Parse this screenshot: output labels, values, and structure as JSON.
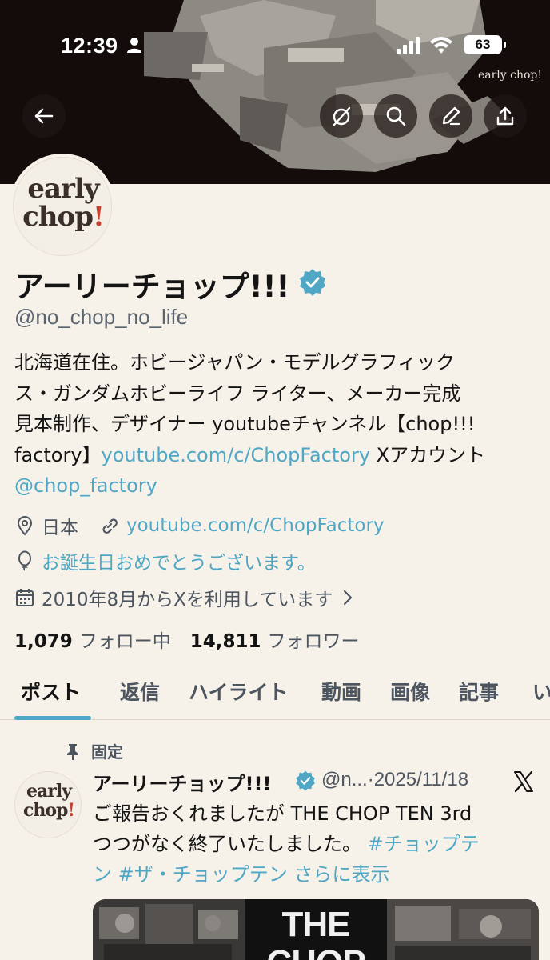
{
  "status_bar": {
    "time": "12:39",
    "battery": "63"
  },
  "banner": {
    "brand_text": "early chop!"
  },
  "avatar": {
    "line1": "early",
    "line2": "chop",
    "bang": "!"
  },
  "profile": {
    "display_name": "アーリーチョップ!!!",
    "handle": "@no_chop_no_life",
    "bio": {
      "line1": "北海道在住。ホビージャパン・モデルグラフィック",
      "line2": "ス・ガンダムホビーライフ ライター、メーカー完成",
      "line3": "見本制作、デザイナー youtubeチャンネル【chop!!!",
      "line4_text": "factory】",
      "line4_link": "youtube.com/c/ChopFactory",
      "line4_suffix": " Xアカウント",
      "line5_link": "@chop_factory"
    },
    "location": "日本",
    "website": "youtube.com/c/ChopFactory",
    "birthday": "お誕生日おめでとうございます。",
    "joined": "2010年8月からXを利用しています",
    "following_count": "1,079",
    "following_label": "フォロー中",
    "followers_count": "14,811",
    "followers_label": "フォロワー"
  },
  "tabs": [
    {
      "label": "ポスト",
      "active": true
    },
    {
      "label": "返信"
    },
    {
      "label": "ハイライト"
    },
    {
      "label": "動画"
    },
    {
      "label": "画像"
    },
    {
      "label": "記事"
    },
    {
      "label": "い"
    }
  ],
  "pinned_post": {
    "pinned_label": "固定",
    "author_name": "アーリーチョップ!!!",
    "meta": "@n...·2025/11/18",
    "text_line1": "ご報告おくれましたが THE CHOP TEN 3rd",
    "text_line2_text": "つつがなく終了いたしました。",
    "text_line2_hashtag": "#チョップテ",
    "text_line3_hashtag": "ン #ザ・チョップテン",
    "text_line3_more": "さらに表示",
    "media_title_line1": "THE",
    "media_title_line2": "CHOP"
  },
  "colors": {
    "accent": "#4fa7c5",
    "background": "#f7f2e9",
    "text": "#141414",
    "secondary_text": "#4c5560",
    "avatar_bang": "#c8402e"
  },
  "icons": {
    "back": "arrow-left-icon",
    "grok": "grok-icon",
    "search": "search-icon",
    "edit": "pencil-icon",
    "share": "share-icon",
    "verified": "verified-badge-icon",
    "location": "location-pin-icon",
    "website": "link-icon",
    "birthday": "balloon-icon",
    "joined": "calendar-icon",
    "pin": "pin-icon",
    "x": "x-logo-icon"
  }
}
